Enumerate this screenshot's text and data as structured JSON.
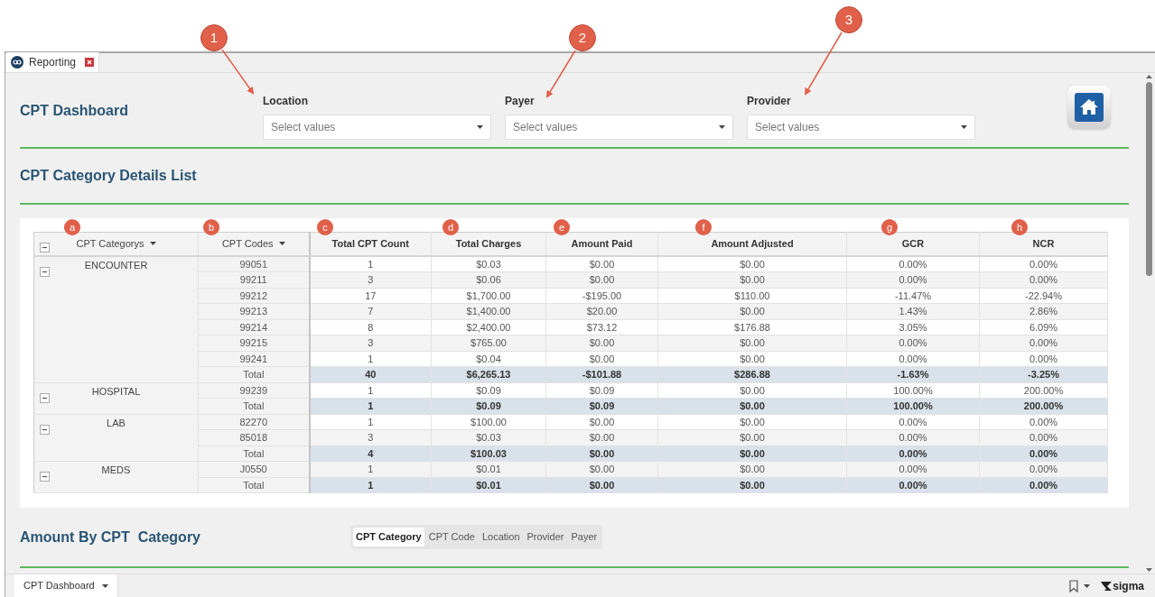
{
  "callouts": [
    {
      "label": "1"
    },
    {
      "label": "2"
    },
    {
      "label": "3"
    }
  ],
  "tab": {
    "label": "Reporting"
  },
  "dashboard": {
    "title": "CPT Dashboard",
    "filters": [
      {
        "label": "Location",
        "placeholder": "Select values"
      },
      {
        "label": "Payer",
        "placeholder": "Select values"
      },
      {
        "label": "Provider",
        "placeholder": "Select values"
      }
    ]
  },
  "details": {
    "title": "CPT Category Details List",
    "table": {
      "columns": [
        {
          "label": "CPT Categorys",
          "marker": "a",
          "sortable": true
        },
        {
          "label": "CPT Codes",
          "marker": "b",
          "sortable": true
        },
        {
          "label": "Total CPT Count",
          "marker": "c",
          "sortable": false
        },
        {
          "label": "Total Charges",
          "marker": "d",
          "sortable": false
        },
        {
          "label": "Amount Paid",
          "marker": "e",
          "sortable": false
        },
        {
          "label": "Amount Adjusted",
          "marker": "f",
          "sortable": false
        },
        {
          "label": "GCR",
          "marker": "g",
          "sortable": false
        },
        {
          "label": "NCR",
          "marker": "h",
          "sortable": false
        }
      ],
      "groups": [
        {
          "category": "ENCOUNTER",
          "expanded": true,
          "rows": [
            {
              "code": "99051",
              "cells": [
                "1",
                "$0.03",
                "$0.00",
                "$0.00",
                "0.00%",
                "0.00%"
              ]
            },
            {
              "code": "99211",
              "cells": [
                "3",
                "$0.06",
                "$0.00",
                "$0.00",
                "0.00%",
                "0.00%"
              ]
            },
            {
              "code": "99212",
              "cells": [
                "17",
                "$1,700.00",
                "-$195.00",
                "$110.00",
                "-11.47%",
                "-22.94%"
              ]
            },
            {
              "code": "99213",
              "cells": [
                "7",
                "$1,400.00",
                "$20.00",
                "$0.00",
                "1.43%",
                "2.86%"
              ]
            },
            {
              "code": "99214",
              "cells": [
                "8",
                "$2,400.00",
                "$73.12",
                "$176.88",
                "3.05%",
                "6.09%"
              ]
            },
            {
              "code": "99215",
              "cells": [
                "3",
                "$765.00",
                "$0.00",
                "$0.00",
                "0.00%",
                "0.00%"
              ]
            },
            {
              "code": "99241",
              "cells": [
                "1",
                "$0.04",
                "$0.00",
                "$0.00",
                "0.00%",
                "0.00%"
              ]
            }
          ],
          "total": {
            "label": "Total",
            "cells": [
              "40",
              "$6,265.13",
              "-$101.88",
              "$286.88",
              "-1.63%",
              "-3.25%"
            ]
          }
        },
        {
          "category": "HOSPITAL",
          "expanded": true,
          "rows": [
            {
              "code": "99239",
              "cells": [
                "1",
                "$0.09",
                "$0.09",
                "$0.00",
                "100.00%",
                "200.00%"
              ]
            }
          ],
          "total": {
            "label": "Total",
            "cells": [
              "1",
              "$0.09",
              "$0.09",
              "$0.00",
              "100.00%",
              "200.00%"
            ]
          }
        },
        {
          "category": "LAB",
          "expanded": true,
          "rows": [
            {
              "code": "82270",
              "cells": [
                "1",
                "$100.00",
                "$0.00",
                "$0.00",
                "0.00%",
                "0.00%"
              ]
            },
            {
              "code": "85018",
              "cells": [
                "3",
                "$0.03",
                "$0.00",
                "$0.00",
                "0.00%",
                "0.00%"
              ]
            }
          ],
          "total": {
            "label": "Total",
            "cells": [
              "4",
              "$100.03",
              "$0.00",
              "$0.00",
              "0.00%",
              "0.00%"
            ]
          }
        },
        {
          "category": "MEDS",
          "expanded": true,
          "rows": [
            {
              "code": "J0550",
              "cells": [
                "1",
                "$0.01",
                "$0.00",
                "$0.00",
                "0.00%",
                "0.00%"
              ]
            }
          ],
          "total": {
            "label": "Total",
            "cells": [
              "1",
              "$0.01",
              "$0.00",
              "$0.00",
              "0.00%",
              "0.00%"
            ]
          }
        }
      ]
    }
  },
  "amount": {
    "title": "Amount By CPT  Category",
    "tabs": [
      {
        "label": "CPT Category",
        "selected": true
      },
      {
        "label": "CPT Code",
        "selected": false
      },
      {
        "label": "Location",
        "selected": false
      },
      {
        "label": "Provider",
        "selected": false
      },
      {
        "label": "Payer",
        "selected": false
      }
    ]
  },
  "bottom_bar": {
    "sheet": "CPT Dashboard",
    "brand": "sigma"
  }
}
